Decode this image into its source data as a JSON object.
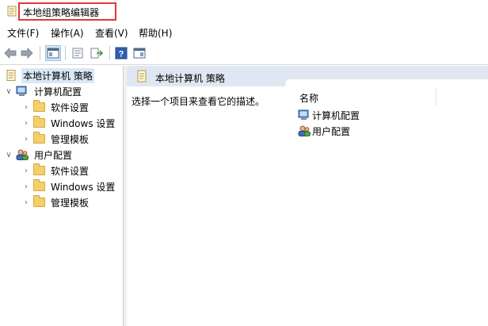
{
  "window": {
    "title": "本地组策略编辑器"
  },
  "menu": [
    {
      "label": "文件(F)"
    },
    {
      "label": "操作(A)"
    },
    {
      "label": "查看(V)"
    },
    {
      "label": "帮助(H)"
    }
  ],
  "tree": {
    "root": "本地计算机 策略",
    "computer": {
      "label": "计算机配置",
      "children": [
        "软件设置",
        "Windows 设置",
        "管理模板"
      ]
    },
    "user": {
      "label": "用户配置",
      "children": [
        "软件设置",
        "Windows 设置",
        "管理模板"
      ]
    }
  },
  "content": {
    "header": "本地计算机 策略",
    "description": "选择一个项目来查看它的描述。",
    "column_name": "名称",
    "items": [
      "计算机配置",
      "用户配置"
    ]
  },
  "colors": {
    "selection": "#d9e8f7",
    "header_bg": "#dfe7f2",
    "title_highlight": "#e0393a"
  }
}
